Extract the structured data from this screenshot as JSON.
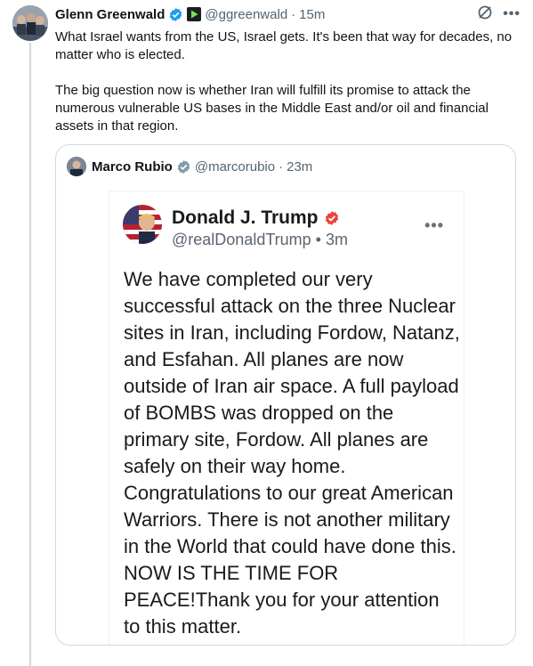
{
  "tweet": {
    "display_name": "Glenn Greenwald",
    "handle": "@ggreenwald",
    "time": "15m",
    "paragraphs": [
      "What Israel wants from the US, Israel gets. It's been that way for decades, no matter who is elected.",
      "The big question now is whether Iran will fulfill its promise to attack the numerous vulnerable US bases in the Middle East and/or oil and financial assets in that region."
    ],
    "more_label": "•••"
  },
  "quote": {
    "display_name": "Marco Rubio",
    "handle": "@marcorubio",
    "time": "23m"
  },
  "embed": {
    "display_name": "Donald J. Trump",
    "handle_time": "@realDonaldTrump • 3m",
    "more_label": "•••",
    "body": "We have completed our very successful attack on the three Nuclear sites in Iran, including Fordow, Natanz, and Esfahan. All planes are now outside of Iran air space. A full payload of BOMBS was dropped on the primary site, Fordow. All planes are safely on their way home. Congratulations to our great American Warriors. There is not another military in the World that could have done this. NOW IS THE TIME FOR PEACE!Thank you for your attention to this matter."
  },
  "colors": {
    "verified_blue": "#1d9bf0",
    "truth_badge": "#e8453c",
    "secondary_text": "#536471",
    "border": "#cfd9de"
  }
}
